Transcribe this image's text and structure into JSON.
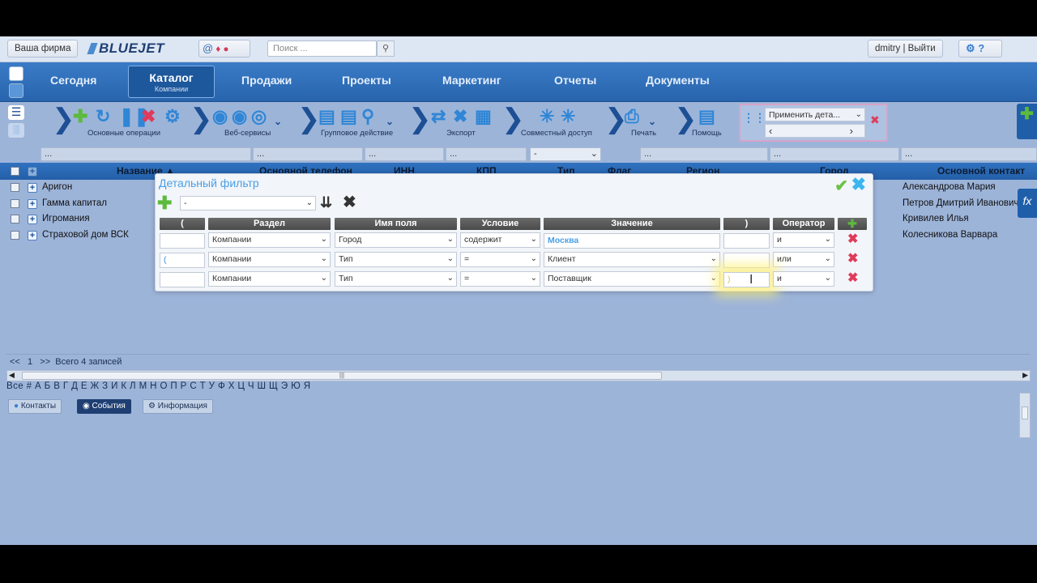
{
  "topbar": {
    "company_button": "Ваша фирма",
    "logo": "BLUEJET",
    "search_placeholder": "Поиск ...",
    "user_label": "dmitry | Выйти"
  },
  "nav": {
    "items": [
      "Сегодня",
      "Продажи",
      "Проекты",
      "Маркетинг",
      "Отчеты",
      "Документы"
    ],
    "active_label": "Каталог",
    "active_sub": "Компании"
  },
  "toolbar": {
    "groups": [
      "Основные операции",
      "Веб-сервисы",
      "Групповое действие",
      "Экспорт",
      "Совместный доступ",
      "Печать",
      "Помощь"
    ],
    "apply_select": "Применить дета..."
  },
  "grid": {
    "filter_cells": [
      "...",
      "...",
      "...",
      "...",
      "-",
      "...",
      "...",
      "..."
    ],
    "columns": [
      "Название ▲",
      "Основной телефон",
      "ИНН",
      "КПП",
      "Тип",
      "Флаг",
      "Регион",
      "Город",
      "Основной контакт"
    ],
    "rows": [
      {
        "name": "Аригон",
        "contact": "Александрова Мария"
      },
      {
        "name": "Гамма капитал",
        "contact": "Петров Дмитрий Иванович"
      },
      {
        "name": "Игромания",
        "contact": "Кривилев Илья"
      },
      {
        "name": "Страховой дом ВСК",
        "contact": "Колесникова Варвара"
      }
    ]
  },
  "modal": {
    "title": "Детальный фильтр",
    "preset_select": "-",
    "headers": [
      "(",
      "Раздел",
      "Имя поля",
      "Условие",
      "Значение",
      ")",
      "Оператор"
    ],
    "rows": [
      {
        "open": "",
        "section": "Компании",
        "field": "Город",
        "condition": "содержит",
        "value": "Москва",
        "close": "",
        "operator": "и"
      },
      {
        "open": "(",
        "section": "Компании",
        "field": "Тип",
        "condition": "=",
        "value": "Клиент",
        "close": "",
        "operator": "или"
      },
      {
        "open": "",
        "section": "Компании",
        "field": "Тип",
        "condition": "=",
        "value": "Поставщик",
        "close": ")",
        "operator": "и"
      }
    ]
  },
  "pager": {
    "text": "<<   1   >>  Всего 4 записей"
  },
  "alphabet": "Все # А Б В Г Д Е Ж З И К Л М Н О П Р С Т У Ф Х Ц Ч Ш Щ Э Ю Я",
  "bottom_tabs": [
    "Контакты",
    "События",
    "Информация"
  ],
  "colors": {
    "nav": "#2864ad",
    "background": "#9db4d9",
    "accent_title": "#4a9fe6",
    "delete": "#e03a5a",
    "ok": "#6cc04a"
  }
}
